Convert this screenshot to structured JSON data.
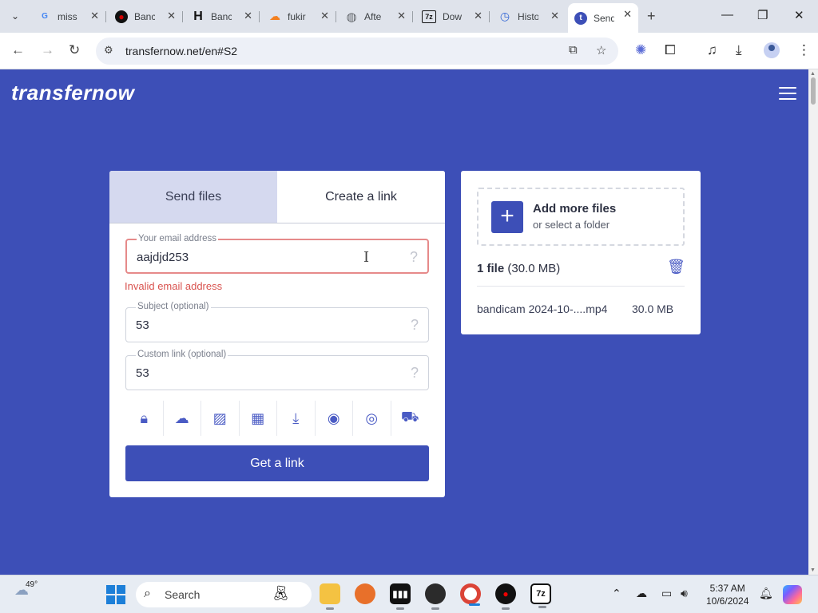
{
  "browser": {
    "tabs": [
      {
        "title": "miss",
        "favicon": "G",
        "favicon_color": "#4285f4",
        "favicon_bg": "transparent"
      },
      {
        "title": "Banc",
        "favicon": "●",
        "favicon_color": "#d10000",
        "favicon_bg": "transparent"
      },
      {
        "title": "Banc",
        "favicon": "H",
        "favicon_color": "#111111",
        "favicon_bg": "transparent"
      },
      {
        "title": "fukir",
        "favicon": "☁",
        "favicon_color": "#f38020",
        "favicon_bg": "transparent"
      },
      {
        "title": "Afte",
        "favicon": "◍",
        "favicon_color": "#5f6368",
        "favicon_bg": "transparent"
      },
      {
        "title": "Dow",
        "favicon": "7z",
        "favicon_color": "#111111",
        "favicon_bg": "transparent"
      },
      {
        "title": "Histo",
        "favicon": "◷",
        "favicon_color": "#3367d6",
        "favicon_bg": "transparent"
      },
      {
        "title": "Send",
        "favicon": "t",
        "favicon_color": "#ffffff",
        "favicon_bg": "#3d4fb7",
        "active": true
      }
    ],
    "url": "transfernow.net/en#S2"
  },
  "page": {
    "logo": "transfernow",
    "tabs": {
      "send": "Send files",
      "create": "Create a link"
    },
    "email": {
      "label": "Your email address",
      "value": "aajdjd253",
      "error": "Invalid email address"
    },
    "subject": {
      "label": "Subject (optional)",
      "value": "53"
    },
    "custom_link": {
      "label": "Custom link (optional)",
      "value": "53"
    },
    "option_icons": [
      "lock-icon",
      "cloud-upload-icon",
      "image-icon",
      "calendar-icon",
      "download-icon",
      "globe-icon",
      "eye-icon",
      "cart-icon"
    ],
    "get_link": "Get a link",
    "files": {
      "add_title": "Add more files",
      "add_sub": "or select a folder",
      "count_bold": "1 file",
      "count_size": " (30.0 MB)",
      "items": [
        {
          "name": "bandicam 2024-10-....mp4",
          "size": "30.0 MB"
        }
      ]
    }
  },
  "taskbar": {
    "weather": "49°",
    "search": "Search",
    "time": "5:37 AM",
    "date": "10/6/2024"
  },
  "colors": {
    "brand": "#3d4fb7",
    "error": "#d9534f"
  }
}
